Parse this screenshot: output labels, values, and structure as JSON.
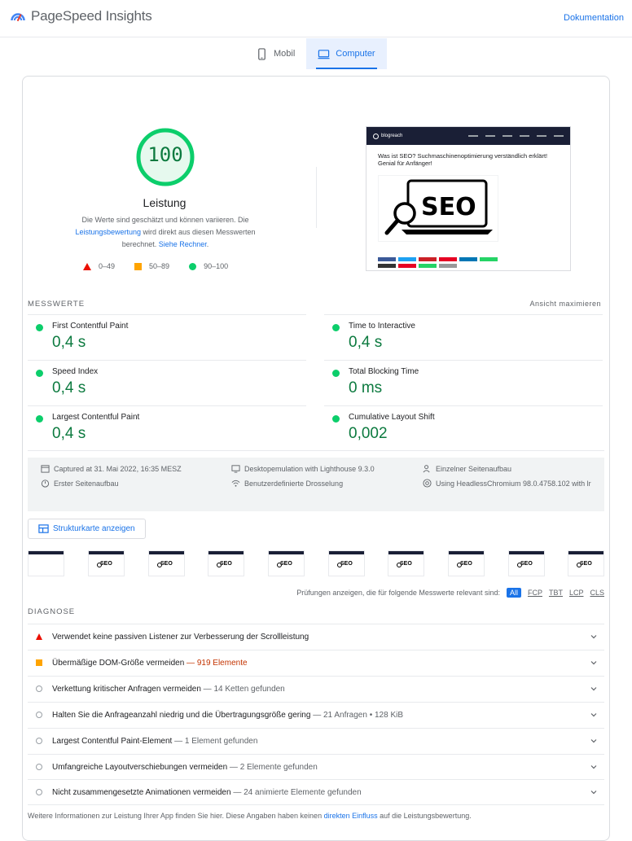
{
  "header": {
    "app_title": "PageSpeed Insights",
    "doc_link": "Dokumentation"
  },
  "tabs": [
    {
      "label": "Mobil",
      "icon": "phone-icon",
      "active": false
    },
    {
      "label": "Computer",
      "icon": "desktop-icon",
      "active": true
    }
  ],
  "score": {
    "value": 100,
    "title": "Leistung",
    "desc_1": "Die Werte sind geschätzt und können variieren. Die",
    "desc_link_1": "Leistungsbewertung",
    "desc_2": " wird direkt aus diesen Messwerten berechnet. ",
    "desc_link_2": "Siehe Rechner",
    "desc_3": ".",
    "color": "#0cce6b"
  },
  "legend": [
    {
      "label": "0–49",
      "shape": "triangle",
      "color": "#eb0f00"
    },
    {
      "label": "50–89",
      "shape": "square",
      "color": "#ffa400"
    },
    {
      "label": "90–100",
      "shape": "circle",
      "color": "#0cce6b"
    }
  ],
  "screenshot": {
    "site_name": "blogreach",
    "headline": "Was ist SEO? Suchmaschinenoptimierung verständlich erklärt! Genial für Anfänger!",
    "image_text": "SEO"
  },
  "metrics_section": {
    "label": "MESSWERTE",
    "expand": "Ansicht maximieren",
    "items": [
      {
        "label": "First Contentful Paint",
        "value": "0,4 s"
      },
      {
        "label": "Time to Interactive",
        "value": "0,4 s"
      },
      {
        "label": "Speed Index",
        "value": "0,4 s"
      },
      {
        "label": "Total Blocking Time",
        "value": "0 ms"
      },
      {
        "label": "Largest Contentful Paint",
        "value": "0,4 s"
      },
      {
        "label": "Cumulative Layout Shift",
        "value": "0,002"
      }
    ]
  },
  "runtime_info": [
    {
      "icon": "calendar-icon",
      "text": "Captured at 31. Mai 2022, 16:35 MESZ"
    },
    {
      "icon": "monitor-icon",
      "text": "Desktopemulation with Lighthouse 9.3.0"
    },
    {
      "icon": "users-icon",
      "text": "Einzelner Seitenaufbau"
    },
    {
      "icon": "timer-icon",
      "text": "Erster Seitenaufbau"
    },
    {
      "icon": "wifi-icon",
      "text": "Benutzerdefinierte Drosselung"
    },
    {
      "icon": "chrome-icon",
      "text": "Using HeadlessChromium 98.0.4758.102 with lr"
    }
  ],
  "treemap_button": "Strukturkarte anzeigen",
  "audit_filter": {
    "prefix": "Prüfungen anzeigen, die für folgende Messwerte relevant sind:",
    "chips": [
      "All",
      "FCP",
      "TBT",
      "LCP",
      "CLS"
    ]
  },
  "diagnostics": {
    "label": "DIAGNOSE",
    "items": [
      {
        "status": "fail",
        "title": "Verwendet keine passiven Listener zur Verbesserung der Scrollleistung",
        "extra": ""
      },
      {
        "status": "average",
        "title": "Übermäßige DOM-Größe vermeiden",
        "extra": " — 919 Elemente"
      },
      {
        "status": "info",
        "title": "Verkettung kritischer Anfragen vermeiden",
        "extra": " — 14 Ketten gefunden"
      },
      {
        "status": "info",
        "title": "Halten Sie die Anfrageanzahl niedrig und die Übertragungsgröße gering",
        "extra": " — 21 Anfragen • 128 KiB"
      },
      {
        "status": "info",
        "title": "Largest Contentful Paint-Element",
        "extra": " — 1 Element gefunden"
      },
      {
        "status": "info",
        "title": "Umfangreiche Layoutverschiebungen vermeiden",
        "extra": " — 2 Elemente gefunden"
      },
      {
        "status": "info",
        "title": "Nicht zusammengesetzte Animationen vermeiden",
        "extra": " — 24 animierte Elemente gefunden"
      }
    ]
  },
  "footnote": {
    "pre": "Weitere Informationen zur Leistung Ihrer App finden Sie hier. Diese Angaben haben keinen ",
    "link": "direkten Einfluss",
    "post": " auf die Leistungsbewertung."
  }
}
